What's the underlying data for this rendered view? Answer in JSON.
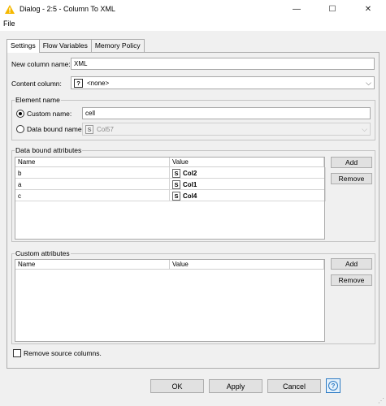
{
  "window": {
    "title": "Dialog - 2:5 - Column To XML",
    "minimize": "—",
    "maximize": "☐",
    "close": "✕"
  },
  "menu": {
    "file": "File"
  },
  "tabs": [
    {
      "label": "Settings",
      "active": true
    },
    {
      "label": "Flow Variables",
      "active": false
    },
    {
      "label": "Memory Policy",
      "active": false
    }
  ],
  "settings": {
    "new_column_label": "New column name:",
    "new_column_value": "XML",
    "content_column_label": "Content column:",
    "content_column_badge": "?",
    "content_column_value": "<none>",
    "element_name_group": "Element name",
    "custom_name_label": "Custom name:",
    "custom_name_value": "cell",
    "custom_name_checked": true,
    "data_bound_name_label": "Data bound name:",
    "data_bound_name_badge": "S",
    "data_bound_name_value": "Col57",
    "data_bound_attrs_group": "Data bound attributes",
    "data_bound_attrs": {
      "columns": [
        "Name",
        "Value"
      ],
      "rows": [
        {
          "name": "b",
          "badge": "S",
          "value": "Col2"
        },
        {
          "name": "a",
          "badge": "S",
          "value": "Col1"
        },
        {
          "name": "c",
          "badge": "S",
          "value": "Col4"
        }
      ],
      "add_label": "Add",
      "remove_label": "Remove"
    },
    "custom_attrs_group": "Custom attributes",
    "custom_attrs": {
      "columns": [
        "Name",
        "Value"
      ],
      "rows": [],
      "add_label": "Add",
      "remove_label": "Remove"
    },
    "remove_source_label": "Remove source columns.",
    "remove_source_checked": false
  },
  "footer": {
    "ok": "OK",
    "apply": "Apply",
    "cancel": "Cancel",
    "help": "?"
  },
  "colors": {
    "title_icon": "#f5b800",
    "help_accent": "#2e7bc4"
  }
}
